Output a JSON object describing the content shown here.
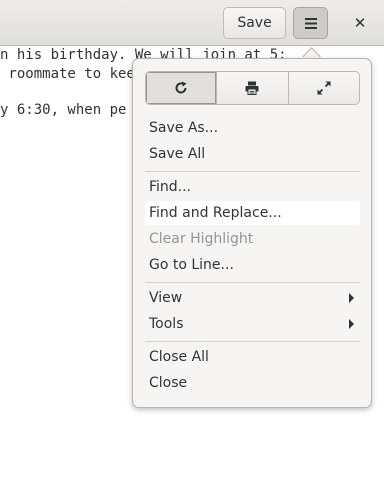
{
  "header": {
    "save_label": "Save",
    "menu_icon": "hamburger-icon",
    "close_label": "✕"
  },
  "document": {
    "lines": [
      "n his birthday. We will join at 5:",
      " roommate to kee",
      "",
      "y 6:30, when pe"
    ]
  },
  "menu": {
    "icon_buttons": [
      {
        "icon": "reload-icon"
      },
      {
        "icon": "print-icon"
      },
      {
        "icon": "fullscreen-icon"
      }
    ],
    "items": [
      {
        "label": "Save As..."
      },
      {
        "label": "Save All"
      },
      {
        "label": "Find..."
      },
      {
        "label": "Find and Replace..."
      },
      {
        "label": "Clear Highlight"
      },
      {
        "label": "Go to Line..."
      },
      {
        "label": "View"
      },
      {
        "label": "Tools"
      },
      {
        "label": "Close All"
      },
      {
        "label": "Close"
      }
    ]
  }
}
